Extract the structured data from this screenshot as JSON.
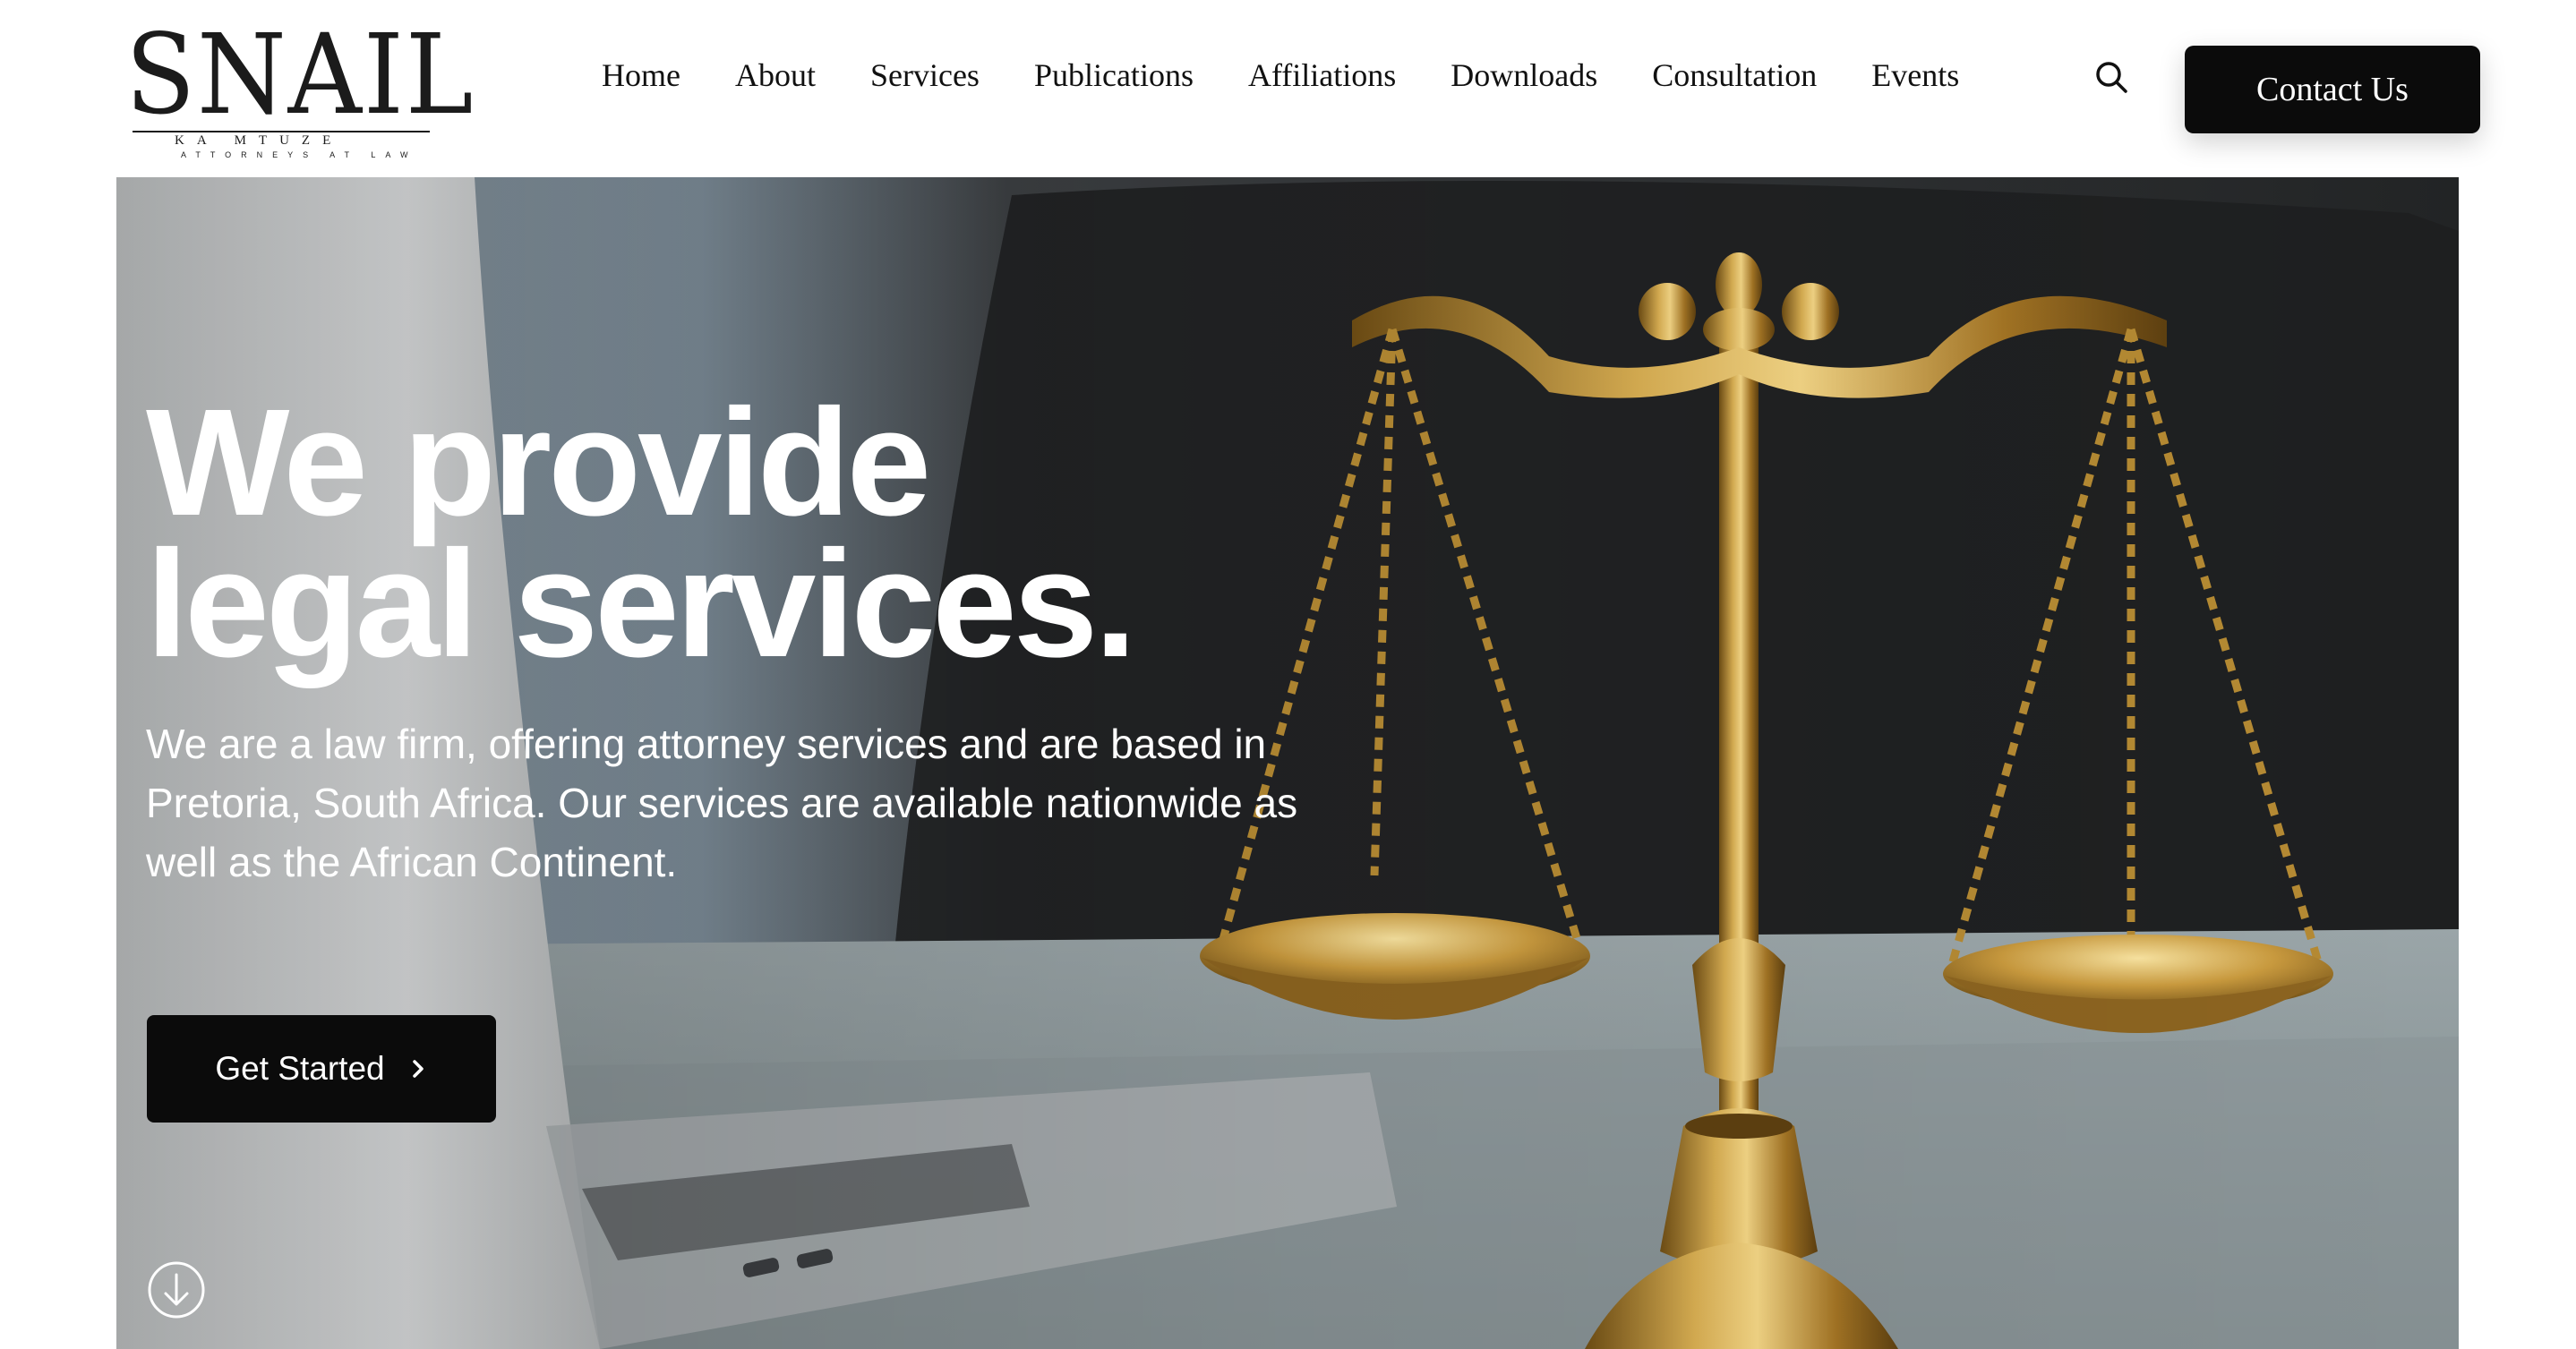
{
  "brand": {
    "name": "SNAIL",
    "tagline": "KA MTUZE",
    "subtitle": "ATTORNEYS AT LAW"
  },
  "nav": {
    "items": [
      "Home",
      "About",
      "Services",
      "Publications",
      "Affiliations",
      "Downloads",
      "Consultation",
      "Events"
    ],
    "search_icon": "search-icon",
    "contact_label": "Contact Us"
  },
  "hero": {
    "title_line1": "We provide",
    "title_line2": "legal services.",
    "description": "We are a law firm, offering attorney services and are based in Pretoria, South Africa. Our services are available nationwide as well as the African Continent.",
    "cta_label": "Get Started",
    "cta_icon": "chevron-right-icon",
    "scroll_icon": "arrow-down-circle-icon",
    "background_image": "scales-of-justice-photo"
  },
  "colors": {
    "button_bg": "#0b0b0b",
    "text_dark": "#111111",
    "brass": "#b98a2a"
  }
}
